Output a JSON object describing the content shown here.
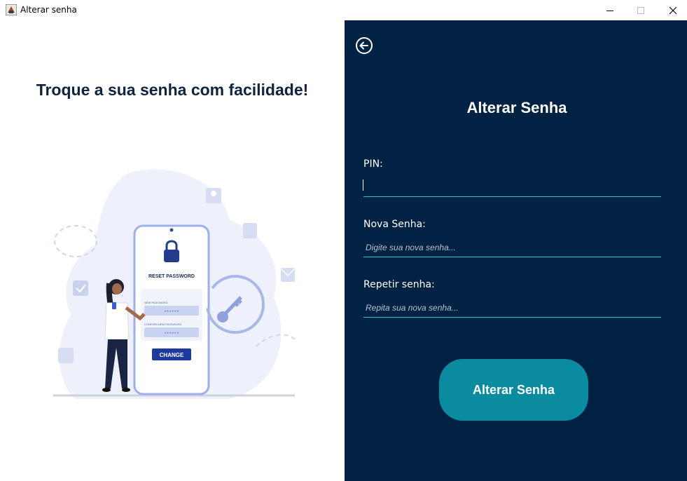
{
  "window": {
    "title": "Alterar senha",
    "icon": "java-app-icon",
    "controls": [
      "minimize-icon",
      "maximize-icon",
      "close-icon"
    ]
  },
  "left": {
    "headline": "Troque a sua senha com facilidade!",
    "illustration": {
      "description_icon": "reset-password-illustration",
      "phone_heading": "RESET PASSWORD",
      "new_password_label": "NEW PASSWORD",
      "confirm_label": "CONFIRM NEW PASSWORD",
      "masked_value": "••••••",
      "change_button": "CHANGE"
    }
  },
  "form": {
    "back_icon": "arrow-left-circle-icon",
    "title": "Alterar Senha",
    "pin": {
      "label": "PIN:",
      "value": "",
      "placeholder": ""
    },
    "new_password": {
      "label": "Nova Senha:",
      "value": "",
      "placeholder": "Digite sua nova senha..."
    },
    "repeat_password": {
      "label": "Repetir senha:",
      "value": "",
      "placeholder": "Repita sua nova senha..."
    },
    "submit_label": "Alterar Senha"
  },
  "colors": {
    "panel_bg": "#022244",
    "accent_line": "#2fc2cf",
    "button_bg": "#0b8ba0",
    "headline": "#10233f"
  }
}
